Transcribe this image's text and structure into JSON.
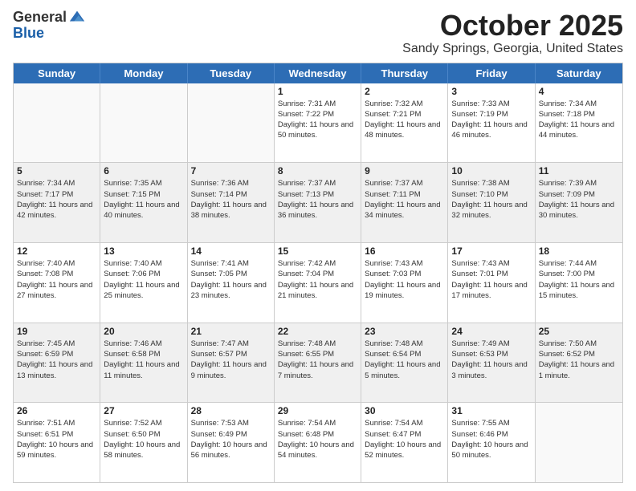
{
  "header": {
    "logo_line1": "General",
    "logo_line2": "Blue",
    "month_title": "October 2025",
    "location": "Sandy Springs, Georgia, United States"
  },
  "days_of_week": [
    "Sunday",
    "Monday",
    "Tuesday",
    "Wednesday",
    "Thursday",
    "Friday",
    "Saturday"
  ],
  "weeks": [
    [
      {
        "day": "",
        "sunrise": "",
        "sunset": "",
        "daylight": ""
      },
      {
        "day": "",
        "sunrise": "",
        "sunset": "",
        "daylight": ""
      },
      {
        "day": "",
        "sunrise": "",
        "sunset": "",
        "daylight": ""
      },
      {
        "day": "1",
        "sunrise": "Sunrise: 7:31 AM",
        "sunset": "Sunset: 7:22 PM",
        "daylight": "Daylight: 11 hours and 50 minutes."
      },
      {
        "day": "2",
        "sunrise": "Sunrise: 7:32 AM",
        "sunset": "Sunset: 7:21 PM",
        "daylight": "Daylight: 11 hours and 48 minutes."
      },
      {
        "day": "3",
        "sunrise": "Sunrise: 7:33 AM",
        "sunset": "Sunset: 7:19 PM",
        "daylight": "Daylight: 11 hours and 46 minutes."
      },
      {
        "day": "4",
        "sunrise": "Sunrise: 7:34 AM",
        "sunset": "Sunset: 7:18 PM",
        "daylight": "Daylight: 11 hours and 44 minutes."
      }
    ],
    [
      {
        "day": "5",
        "sunrise": "Sunrise: 7:34 AM",
        "sunset": "Sunset: 7:17 PM",
        "daylight": "Daylight: 11 hours and 42 minutes."
      },
      {
        "day": "6",
        "sunrise": "Sunrise: 7:35 AM",
        "sunset": "Sunset: 7:15 PM",
        "daylight": "Daylight: 11 hours and 40 minutes."
      },
      {
        "day": "7",
        "sunrise": "Sunrise: 7:36 AM",
        "sunset": "Sunset: 7:14 PM",
        "daylight": "Daylight: 11 hours and 38 minutes."
      },
      {
        "day": "8",
        "sunrise": "Sunrise: 7:37 AM",
        "sunset": "Sunset: 7:13 PM",
        "daylight": "Daylight: 11 hours and 36 minutes."
      },
      {
        "day": "9",
        "sunrise": "Sunrise: 7:37 AM",
        "sunset": "Sunset: 7:11 PM",
        "daylight": "Daylight: 11 hours and 34 minutes."
      },
      {
        "day": "10",
        "sunrise": "Sunrise: 7:38 AM",
        "sunset": "Sunset: 7:10 PM",
        "daylight": "Daylight: 11 hours and 32 minutes."
      },
      {
        "day": "11",
        "sunrise": "Sunrise: 7:39 AM",
        "sunset": "Sunset: 7:09 PM",
        "daylight": "Daylight: 11 hours and 30 minutes."
      }
    ],
    [
      {
        "day": "12",
        "sunrise": "Sunrise: 7:40 AM",
        "sunset": "Sunset: 7:08 PM",
        "daylight": "Daylight: 11 hours and 27 minutes."
      },
      {
        "day": "13",
        "sunrise": "Sunrise: 7:40 AM",
        "sunset": "Sunset: 7:06 PM",
        "daylight": "Daylight: 11 hours and 25 minutes."
      },
      {
        "day": "14",
        "sunrise": "Sunrise: 7:41 AM",
        "sunset": "Sunset: 7:05 PM",
        "daylight": "Daylight: 11 hours and 23 minutes."
      },
      {
        "day": "15",
        "sunrise": "Sunrise: 7:42 AM",
        "sunset": "Sunset: 7:04 PM",
        "daylight": "Daylight: 11 hours and 21 minutes."
      },
      {
        "day": "16",
        "sunrise": "Sunrise: 7:43 AM",
        "sunset": "Sunset: 7:03 PM",
        "daylight": "Daylight: 11 hours and 19 minutes."
      },
      {
        "day": "17",
        "sunrise": "Sunrise: 7:43 AM",
        "sunset": "Sunset: 7:01 PM",
        "daylight": "Daylight: 11 hours and 17 minutes."
      },
      {
        "day": "18",
        "sunrise": "Sunrise: 7:44 AM",
        "sunset": "Sunset: 7:00 PM",
        "daylight": "Daylight: 11 hours and 15 minutes."
      }
    ],
    [
      {
        "day": "19",
        "sunrise": "Sunrise: 7:45 AM",
        "sunset": "Sunset: 6:59 PM",
        "daylight": "Daylight: 11 hours and 13 minutes."
      },
      {
        "day": "20",
        "sunrise": "Sunrise: 7:46 AM",
        "sunset": "Sunset: 6:58 PM",
        "daylight": "Daylight: 11 hours and 11 minutes."
      },
      {
        "day": "21",
        "sunrise": "Sunrise: 7:47 AM",
        "sunset": "Sunset: 6:57 PM",
        "daylight": "Daylight: 11 hours and 9 minutes."
      },
      {
        "day": "22",
        "sunrise": "Sunrise: 7:48 AM",
        "sunset": "Sunset: 6:55 PM",
        "daylight": "Daylight: 11 hours and 7 minutes."
      },
      {
        "day": "23",
        "sunrise": "Sunrise: 7:48 AM",
        "sunset": "Sunset: 6:54 PM",
        "daylight": "Daylight: 11 hours and 5 minutes."
      },
      {
        "day": "24",
        "sunrise": "Sunrise: 7:49 AM",
        "sunset": "Sunset: 6:53 PM",
        "daylight": "Daylight: 11 hours and 3 minutes."
      },
      {
        "day": "25",
        "sunrise": "Sunrise: 7:50 AM",
        "sunset": "Sunset: 6:52 PM",
        "daylight": "Daylight: 11 hours and 1 minute."
      }
    ],
    [
      {
        "day": "26",
        "sunrise": "Sunrise: 7:51 AM",
        "sunset": "Sunset: 6:51 PM",
        "daylight": "Daylight: 10 hours and 59 minutes."
      },
      {
        "day": "27",
        "sunrise": "Sunrise: 7:52 AM",
        "sunset": "Sunset: 6:50 PM",
        "daylight": "Daylight: 10 hours and 58 minutes."
      },
      {
        "day": "28",
        "sunrise": "Sunrise: 7:53 AM",
        "sunset": "Sunset: 6:49 PM",
        "daylight": "Daylight: 10 hours and 56 minutes."
      },
      {
        "day": "29",
        "sunrise": "Sunrise: 7:54 AM",
        "sunset": "Sunset: 6:48 PM",
        "daylight": "Daylight: 10 hours and 54 minutes."
      },
      {
        "day": "30",
        "sunrise": "Sunrise: 7:54 AM",
        "sunset": "Sunset: 6:47 PM",
        "daylight": "Daylight: 10 hours and 52 minutes."
      },
      {
        "day": "31",
        "sunrise": "Sunrise: 7:55 AM",
        "sunset": "Sunset: 6:46 PM",
        "daylight": "Daylight: 10 hours and 50 minutes."
      },
      {
        "day": "",
        "sunrise": "",
        "sunset": "",
        "daylight": ""
      }
    ]
  ]
}
